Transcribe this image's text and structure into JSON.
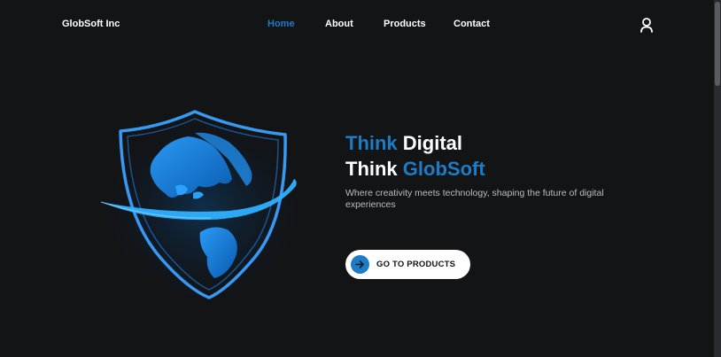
{
  "header": {
    "brand": "GlobSoft Inc",
    "nav": [
      {
        "label": "Home",
        "active": true
      },
      {
        "label": "About",
        "active": false
      },
      {
        "label": "Products",
        "active": false
      },
      {
        "label": "Contact",
        "active": false
      }
    ],
    "user_icon": "user-icon"
  },
  "hero": {
    "line1_accent": "Think",
    "line1_rest": "Digital",
    "line2_start": "Think",
    "line2_accent": "GlobSoft",
    "tagline": "Where creativity meets technology, shaping the future of digital experiences",
    "cta_label": "GO TO PRODUCTS",
    "cta_icon": "arrow-right-icon",
    "art_icon": "shield-globe-icon"
  },
  "colors": {
    "background": "#131416",
    "accent": "#1c7cc6",
    "text": "#ffffff",
    "muted": "#b9bcc2"
  }
}
